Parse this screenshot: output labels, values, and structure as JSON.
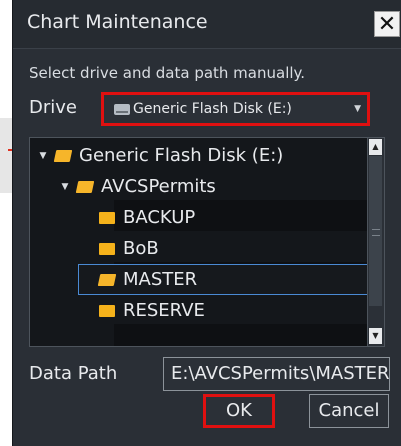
{
  "dialog": {
    "title": "Chart Maintenance",
    "close_glyph": "✕",
    "instruction": "Select drive and data path manually.",
    "drive_label": "Drive",
    "drive_value": "Generic Flash Disk (E:)",
    "tree": [
      {
        "label": "Generic Flash Disk (E:)",
        "expanded": true
      },
      {
        "label": "AVCSPermits",
        "expanded": true
      },
      {
        "label": "BACKUP"
      },
      {
        "label": "BoB"
      },
      {
        "label": "MASTER",
        "selected": true
      },
      {
        "label": "RESERVE"
      }
    ],
    "data_path_label": "Data Path",
    "data_path_value": "E:\\AVCSPermits\\MASTER",
    "ok_label": "OK",
    "cancel_label": "Cancel"
  },
  "colors": {
    "background": "#2a2f36",
    "highlight_border": "#e01010",
    "selection_border": "#4a8ad4",
    "folder": "#f5b21b"
  },
  "icons": [
    "close-icon",
    "disk-icon",
    "folder-icon",
    "folder-open-icon",
    "expand-arrow-icon",
    "dropdown-caret-icon"
  ]
}
